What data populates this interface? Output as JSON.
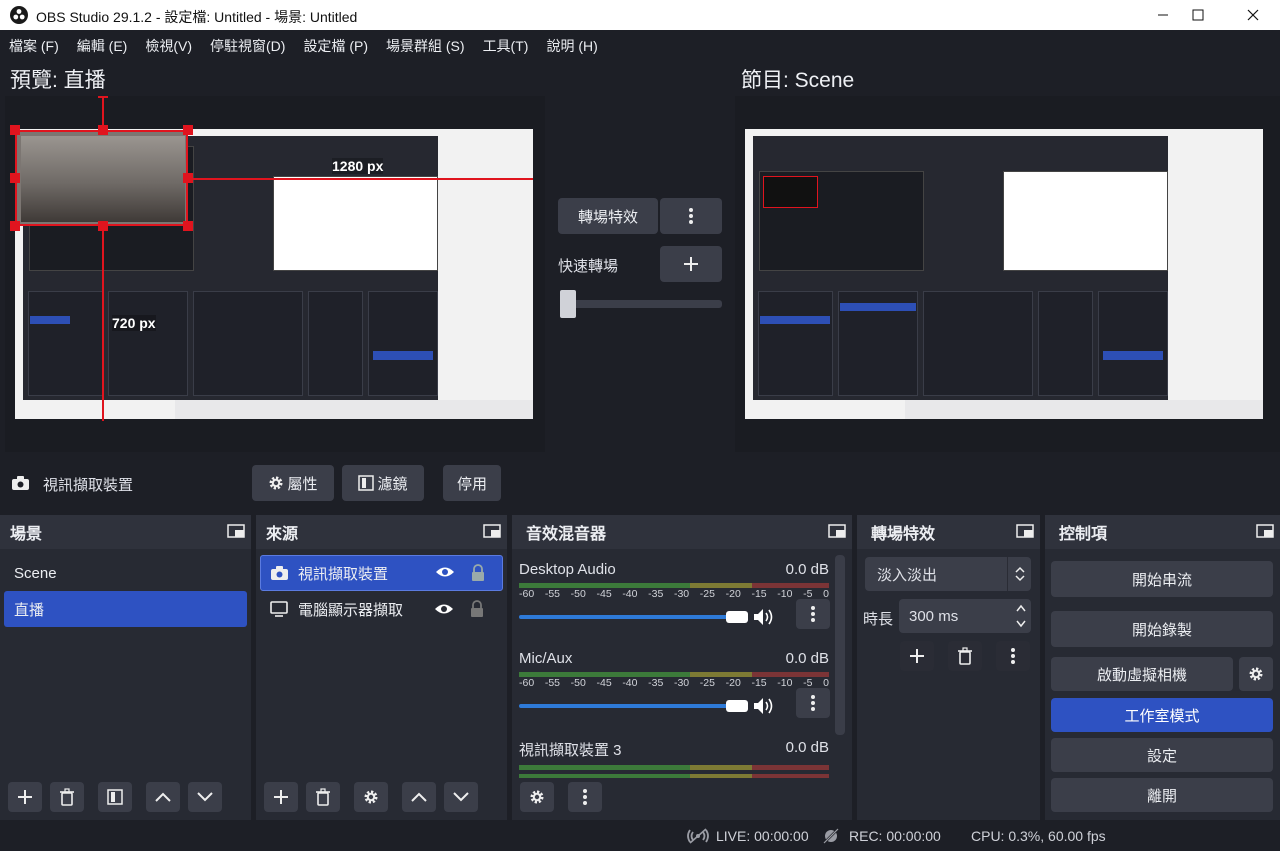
{
  "window": {
    "title": "OBS Studio 29.1.2 - 設定檔: Untitled - 場景: Untitled",
    "minimize_icon": "minimize-icon",
    "maximize_icon": "maximize-icon",
    "close_icon": "close-icon"
  },
  "menu": [
    "檔案 (F)",
    "編輯 (E)",
    "檢視(V)",
    "停駐視窗(D)",
    "設定檔 (P)",
    "場景群組 (S)",
    "工具(T)",
    "說明 (H)"
  ],
  "preview": {
    "title": "預覽: 直播",
    "width_label": "1280 px",
    "height_label": "720 px"
  },
  "program": {
    "title": "節目: Scene"
  },
  "transition_center": {
    "transition_button": "轉場特效",
    "quick_transition_label": "快速轉場",
    "more_icon": "more-vertical-icon",
    "add_icon": "plus-icon"
  },
  "source_toolbar": {
    "source_name": "視訊擷取裝置",
    "properties": "屬性",
    "filters": "濾鏡",
    "deactivate": "停用"
  },
  "scenes": {
    "title": "場景",
    "items": [
      "Scene",
      "直播"
    ],
    "selected_index": 1
  },
  "sources": {
    "title": "來源",
    "items": [
      {
        "name": "視訊擷取裝置",
        "icon": "camera-icon",
        "selected": true
      },
      {
        "name": "電腦顯示器擷取",
        "icon": "monitor-icon",
        "selected": false
      }
    ]
  },
  "mixer": {
    "title": "音效混音器",
    "scale": [
      "-60",
      "-55",
      "-50",
      "-45",
      "-40",
      "-35",
      "-30",
      "-25",
      "-20",
      "-15",
      "-10",
      "-5",
      "0"
    ],
    "channels": [
      {
        "name": "Desktop Audio",
        "db": "0.0 dB",
        "volume": 1.0
      },
      {
        "name": "Mic/Aux",
        "db": "0.0 dB",
        "volume": 1.0
      },
      {
        "name": "視訊擷取裝置 3",
        "db": "0.0 dB",
        "volume": 1.0
      }
    ]
  },
  "transitions": {
    "title": "轉場特效",
    "selected": "淡入淡出",
    "duration_label": "時長",
    "duration_value": "300 ms"
  },
  "controls": {
    "title": "控制項",
    "start_streaming": "開始串流",
    "start_recording": "開始錄製",
    "start_virtual_cam": "啟動虛擬相機",
    "studio_mode": "工作室模式",
    "settings": "設定",
    "exit": "離開"
  },
  "status": {
    "live": "LIVE: 00:00:00",
    "rec": "REC: 00:00:00",
    "cpu": "CPU: 0.3%, 60.00 fps"
  },
  "colors": {
    "accent": "#2e52c2",
    "selection_red": "#e0141e",
    "background": "#1d1f26"
  }
}
